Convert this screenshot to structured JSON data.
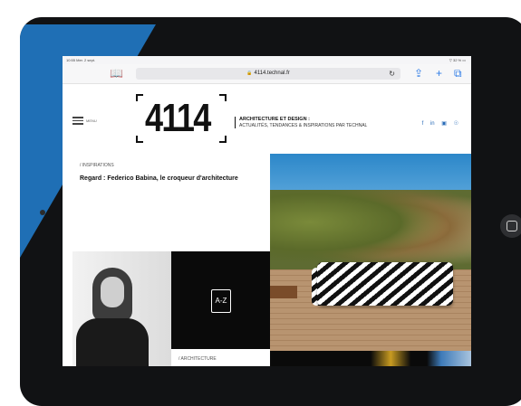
{
  "status_bar": {
    "left": "10:55 Mer. 2 sept.",
    "right": "▽ 32 % ▭"
  },
  "browser": {
    "url": "4114.technal.fr"
  },
  "site": {
    "menu_label": "MENU",
    "logo": "4114",
    "tagline_title": "ARCHITECTURE ET DESIGN :",
    "tagline_sub": "ACTUALITÉS, TENDANCES & INSPIRATIONS PAR TECHNAL",
    "social": [
      "f",
      "in",
      "▣",
      "☉"
    ]
  },
  "articles": [
    {
      "category": "/ INSPIRATIONS",
      "title": "Regard : Federico Babina, le croqueur d'architecture"
    },
    {
      "category": "/ ARCHITECTURE"
    }
  ],
  "az_tile": {
    "label": "A-Z"
  },
  "colors": {
    "accent_blue": "#1f6fb5",
    "link": "#2f7ce6"
  }
}
